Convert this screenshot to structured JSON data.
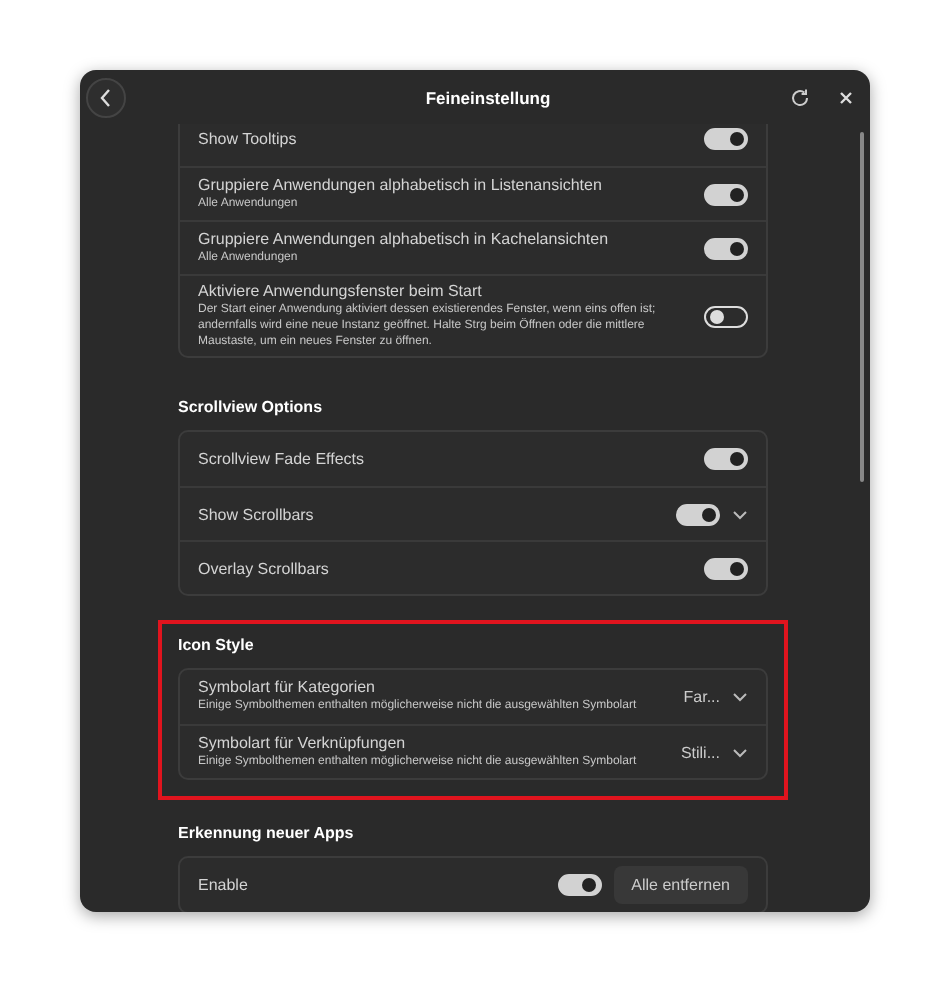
{
  "window": {
    "title": "Feineinstellung"
  },
  "sections": [
    {
      "highlighted": false,
      "rows": [
        {
          "kind": "toggle",
          "label": "Show Tooltips",
          "on": true
        },
        {
          "kind": "toggle",
          "label": "Gruppiere Anwendungen alphabetisch in Listenansichten",
          "subtitle": "Alle Anwendungen",
          "on": true
        },
        {
          "kind": "toggle",
          "label": "Gruppiere Anwendungen alphabetisch in Kachelansichten",
          "subtitle": "Alle Anwendungen",
          "on": true
        },
        {
          "kind": "toggle",
          "label": "Aktiviere Anwendungsfenster beim Start",
          "subtitle": "Der Start einer Anwendung aktiviert dessen existierendes Fenster, wenn eins offen ist; andernfalls wird eine neue Instanz geöffnet. Halte Strg beim Öffnen oder die mittlere Maustaste, um ein neues Fenster zu öffnen.",
          "on": false
        }
      ]
    },
    {
      "title": "Scrollview Options",
      "highlighted": false,
      "rows": [
        {
          "kind": "toggle",
          "label": "Scrollview Fade Effects",
          "on": true
        },
        {
          "kind": "toggle_dropdown",
          "label": "Show Scrollbars",
          "on": true
        },
        {
          "kind": "toggle",
          "label": "Overlay Scrollbars",
          "on": true
        }
      ]
    },
    {
      "title": "Icon Style",
      "highlighted": true,
      "rows": [
        {
          "kind": "dropdown",
          "label": "Symbolart für Kategorien",
          "subtitle": "Einige Symbolthemen enthalten möglicherweise nicht die ausgewählten Symbolart",
          "value": "Far..."
        },
        {
          "kind": "dropdown",
          "label": "Symbolart für Verknüpfungen",
          "subtitle": "Einige Symbolthemen enthalten möglicherweise nicht die ausgewählten Symbolart",
          "value": "Stili..."
        }
      ]
    },
    {
      "title": "Erkennung neuer Apps",
      "highlighted": false,
      "rows": [
        {
          "kind": "toggle_button",
          "label": "Enable",
          "on": true,
          "button": "Alle entfernen"
        }
      ]
    }
  ]
}
